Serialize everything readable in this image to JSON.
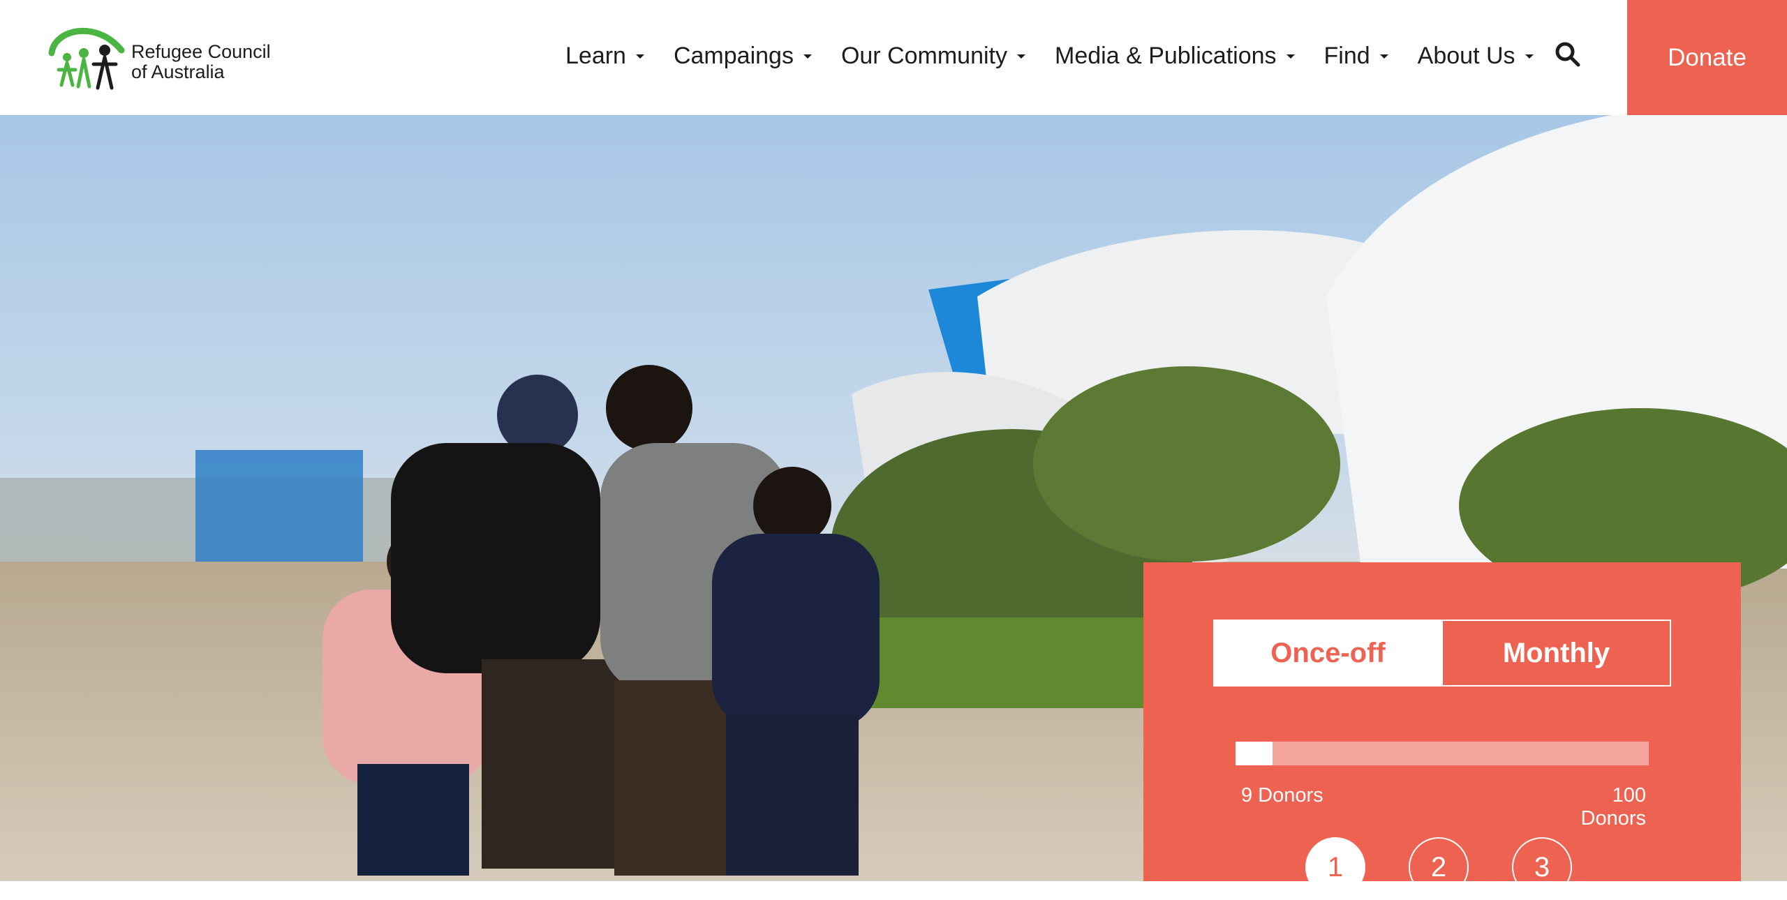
{
  "header": {
    "logo_line1": "Refugee Council",
    "logo_line2": "of Australia",
    "donate_label": "Donate",
    "search_icon": "search-icon",
    "nav": [
      {
        "label": "Learn"
      },
      {
        "label": "Campaings"
      },
      {
        "label": "Our Community"
      },
      {
        "label": "Media & Publications"
      },
      {
        "label": "Find"
      },
      {
        "label": "About Us"
      }
    ]
  },
  "hero": {
    "image": "children-walking-refugee-camp"
  },
  "donation": {
    "once_off_label": "Once-off",
    "monthly_label": "Monthly",
    "selected_frequency": "Once-off",
    "donors_current": 9,
    "donors_goal": 100,
    "donors_min_label": "9 Donors",
    "donors_max_label": "100 Donors",
    "steps": [
      "1",
      "2",
      "3"
    ],
    "active_step": "1"
  },
  "colors": {
    "accent": "#ee6252",
    "logo_green": "#4bb543",
    "text": "#1c1c1c"
  }
}
